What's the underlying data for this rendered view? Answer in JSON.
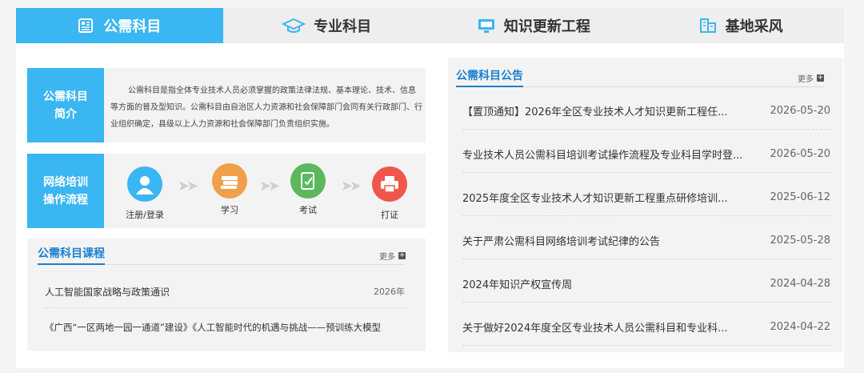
{
  "tabs": [
    {
      "label": "公需科目",
      "icon": "newspaper-icon"
    },
    {
      "label": "专业科目",
      "icon": "graduation-cap-icon"
    },
    {
      "label": "知识更新工程",
      "icon": "monitor-icon"
    },
    {
      "label": "基地采风",
      "icon": "building-icon"
    }
  ],
  "intro": {
    "label_line1": "公需科目",
    "label_line2": "简介",
    "text": "公需科目是指全体专业技术人员必须掌握的政策法律法规、基本理论、技术、信息等方面的普及型知识。公需科目由自治区人力资源和社会保障部门会同有关行政部门、行业组织确定，县级以上人力资源和社会保障部门负责组织实施。"
  },
  "flow": {
    "label_line1": "网络培训",
    "label_line2": "操作流程",
    "steps": [
      {
        "label": "注册/登录",
        "icon": "user-icon",
        "color": "#3ab6f2"
      },
      {
        "label": "学习",
        "icon": "books-icon",
        "color": "#f0a04b"
      },
      {
        "label": "考试",
        "icon": "exam-icon",
        "color": "#5cb85c"
      },
      {
        "label": "打证",
        "icon": "printer-icon",
        "color": "#f0564a"
      }
    ],
    "arrow": "➤➤"
  },
  "courses": {
    "title": "公需科目课程",
    "more": "更多",
    "items": [
      {
        "title": "人工智能国家战略与政策通识",
        "date": "2026年"
      },
      {
        "title": "《广西“一区两地一园一通道”建设》《人工智能时代的机遇与挑战——预训练大模型",
        "date": ""
      }
    ]
  },
  "notices": {
    "title": "公需科目公告",
    "more": "更多",
    "items": [
      {
        "title": "【置顶通知】2026年全区专业技术人才知识更新工程任...",
        "date": "2026-05-20"
      },
      {
        "title": "专业技术人员公需科目培训考试操作流程及专业科目学时登...",
        "date": "2026-05-20"
      },
      {
        "title": "2025年度全区专业技术人才知识更新工程重点研修培训...",
        "date": "2025-06-12"
      },
      {
        "title": "关于严肃公需科目网络培训考试纪律的公告",
        "date": "2025-05-28"
      },
      {
        "title": "2024年知识产权宣传周",
        "date": "2024-04-28"
      },
      {
        "title": "关于做好2024年度全区专业技术人员公需科目和专业科...",
        "date": "2024-04-22"
      }
    ]
  },
  "colors": {
    "accent": "#3ab6f2",
    "link": "#1a7fd0"
  }
}
